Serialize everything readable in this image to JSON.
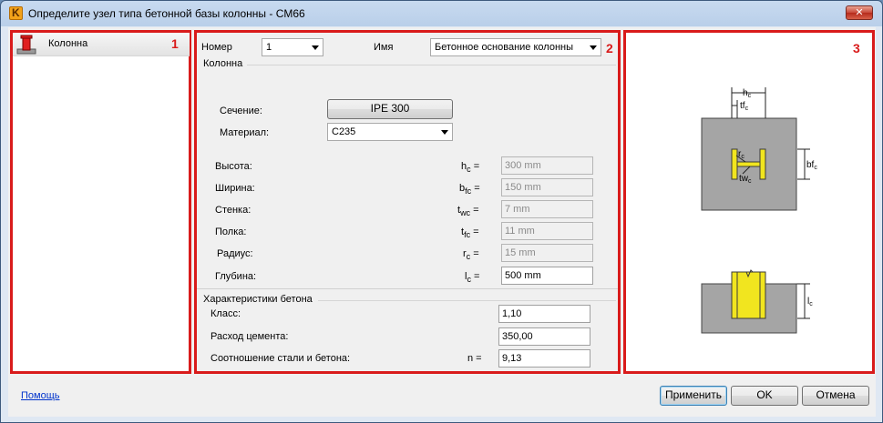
{
  "window": {
    "title": "Определите узел типа бетонной базы колонны - CM66"
  },
  "panels": {
    "p1": "1",
    "p2": "2",
    "p3": "3"
  },
  "tree": {
    "items": [
      {
        "label": "Колонна"
      }
    ]
  },
  "form": {
    "number_label": "Номер",
    "number_value": "1",
    "name_label": "Имя",
    "name_value": "Бетонное основание колонны",
    "column_group": "Колонна",
    "section_label": "Сечение:",
    "section_value": "IPE 300",
    "material_label": "Материал:",
    "material_value": "C235",
    "props": [
      {
        "label": "Высота:",
        "sym": "h",
        "sub": "c",
        "eq": "=",
        "value": "300 mm",
        "enabled": false
      },
      {
        "label": "Ширина:",
        "sym": "b",
        "sub": "fc",
        "eq": "=",
        "value": "150 mm",
        "enabled": false
      },
      {
        "label": "Стенка:",
        "sym": "t",
        "sub": "wc",
        "eq": "=",
        "value": "7 mm",
        "enabled": false
      },
      {
        "label": "Полка:",
        "sym": "t",
        "sub": "fc",
        "eq": "=",
        "value": "11 mm",
        "enabled": false
      },
      {
        "label": "Радиус:",
        "sym": "r",
        "sub": "c",
        "eq": "=",
        "value": "15 mm",
        "enabled": false
      },
      {
        "label": "Глубина:",
        "sym": "l",
        "sub": "c",
        "eq": "=",
        "value": "500 mm",
        "enabled": true
      }
    ],
    "concrete_group": "Характеристики бетона",
    "class_label": "Класс:",
    "class_value": "1,10",
    "cement_label": "Расход цемента:",
    "cement_value": "350,00",
    "ratio_label": "Соотношение стали и бетона:",
    "ratio_sym": "n =",
    "ratio_value": "9,13"
  },
  "diagram": {
    "hc": "h",
    "hc_sub": "c",
    "tfc": "tf",
    "tfc_sub": "c",
    "rc": "r",
    "rc_sub": "c",
    "twc": "tw",
    "twc_sub": "c",
    "bfc": "bf",
    "bfc_sub": "c",
    "lc": "l",
    "lc_sub": "c",
    "colors": {
      "concrete": "#a5a5a5",
      "steel": "#f1e51f",
      "steel_edge": "#3a3a3a",
      "accent": "#d91b1b"
    }
  },
  "footer": {
    "help": "Помощь",
    "apply": "Применить",
    "ok": "OK",
    "cancel": "Отмена"
  },
  "icons": [
    "app-logo-icon",
    "close-icon",
    "column-icon",
    "dropdown-arrow-icon"
  ]
}
